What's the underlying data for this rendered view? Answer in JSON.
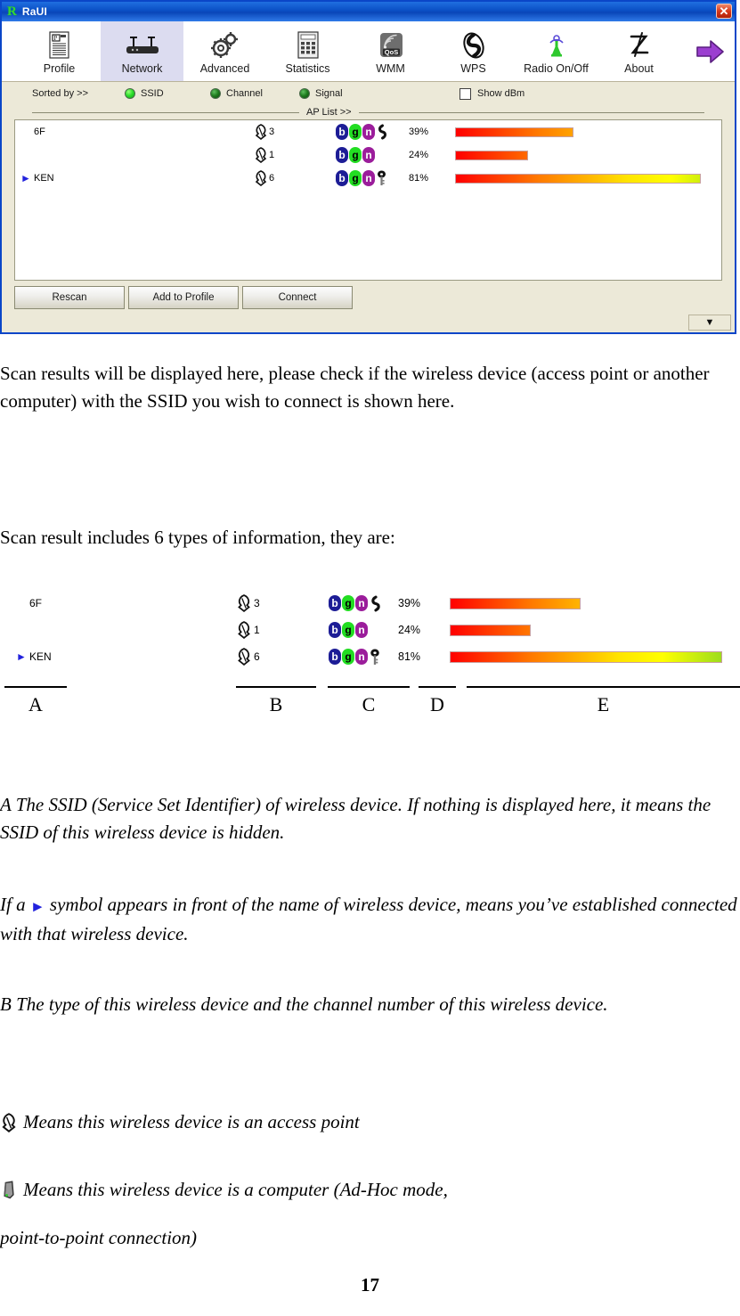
{
  "window": {
    "title": "RaUI",
    "logo_letter": "R",
    "close_label": "✕",
    "toolbar": [
      {
        "label": "Profile",
        "icon": "profile-icon",
        "active": false
      },
      {
        "label": "Network",
        "icon": "router-icon",
        "active": true
      },
      {
        "label": "Advanced",
        "icon": "gears-icon",
        "active": false
      },
      {
        "label": "Statistics",
        "icon": "calculator-icon",
        "active": false
      },
      {
        "label": "WMM",
        "icon": "qos-icon",
        "active": false
      },
      {
        "label": "WPS",
        "icon": "wps-swirl-icon",
        "active": false
      },
      {
        "label": "Radio On/Off",
        "icon": "antenna-icon",
        "active": false
      },
      {
        "label": "About",
        "icon": "signature-icon",
        "active": false
      }
    ],
    "toolbar_arrow_icon": "purple-right-arrow-icon",
    "sortbar": {
      "label": "Sorted by >>",
      "options": [
        {
          "label": "SSID",
          "selected": true
        },
        {
          "label": "Channel",
          "selected": false
        },
        {
          "label": "Signal",
          "selected": false
        }
      ],
      "show_dbm_label": "Show dBm",
      "show_dbm_checked": false
    },
    "aplist_header": "AP List >>",
    "ap_rows": [
      {
        "ssid": "6F",
        "connected": false,
        "channel": "3",
        "caps": [
          "b",
          "g",
          "n"
        ],
        "extra_icon": "wps-swirl-icon",
        "signal": "39%",
        "signal_value": 39
      },
      {
        "ssid": "",
        "connected": false,
        "channel": "1",
        "caps": [
          "b",
          "g",
          "n"
        ],
        "extra_icon": "",
        "signal": "24%",
        "signal_value": 24
      },
      {
        "ssid": "KEN",
        "connected": true,
        "channel": "6",
        "caps": [
          "b",
          "g",
          "n"
        ],
        "extra_icon": "key-icon",
        "signal": "81%",
        "signal_value": 81
      }
    ],
    "buttons": [
      {
        "label": "Rescan"
      },
      {
        "label": "Add to Profile"
      },
      {
        "label": "Connect"
      }
    ],
    "expander_icon": "▼"
  },
  "document": {
    "para1": "Scan results will be displayed here, please check if the wireless device (access point or another computer) with the SSID you wish to connect is shown here.",
    "para2": "Scan result includes 6 types of information, they are:",
    "figure": {
      "labels": [
        "A",
        "B",
        "C",
        "D",
        "E"
      ]
    },
    "paraA": "A      The SSID (Service Set Identifier) of wireless device. If nothing is displayed here, it means the SSID of this wireless device is hidden.",
    "paraA2_before": "If a ",
    "paraA2_after": " symbol appears in front of the name of wireless device, means you’ve established connected with that wireless device.",
    "paraB": "B      The type of this wireless device and the channel number of this wireless device.",
    "bullet_ap": "Means this wireless device is an access point",
    "bullet_adhoc": "Means this wireless device is a computer (Ad-Hoc mode,",
    "bullet_adhoc2": "point-to-point connection)",
    "page_number": "17"
  },
  "colors": {
    "titlebar": "#0a4fc4",
    "window_border": "#0a46c8",
    "panel": "#ece9d8",
    "cap_b": "#1d1d96",
    "cap_g": "#22dd22",
    "cap_n": "#9b1d9b",
    "connected_marker": "#2222dd",
    "active_tab": "#dcdcf0"
  }
}
